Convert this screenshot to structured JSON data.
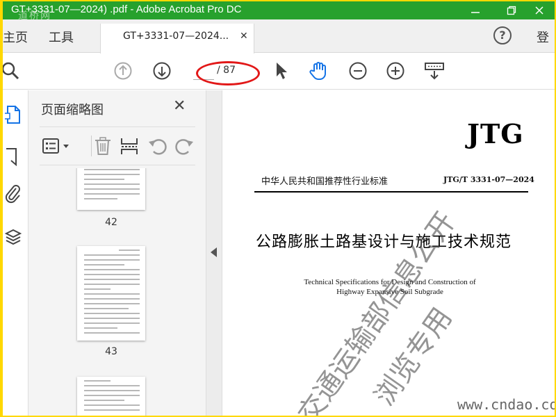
{
  "window": {
    "title": "GT+3331-07—2024)  .pdf - Adobe Acrobat Pro DC",
    "watermark": "道桥网"
  },
  "tabs": {
    "home": "主页",
    "tools": "工具",
    "document": "GT+3331-07—2024...",
    "help": "?",
    "sign_in": "登"
  },
  "toolbar": {
    "page_current": "",
    "page_total": "/ 87"
  },
  "panel": {
    "title": "页面缩略图",
    "thumbnails": [
      {
        "page": "42"
      },
      {
        "page": "43"
      },
      {
        "page": ""
      }
    ]
  },
  "document": {
    "code_mark": "JTG",
    "standard_type": "中华人民共和国推荐性行业标准",
    "standard_code": "JTG/T 3331-07—2024",
    "title_cn": "公路膨胀土路基设计与施工技术规范",
    "title_en_line1": "Technical Specifications for Design and Construction of",
    "title_en_line2": "Highway Expansive Soil Subgrade",
    "watermark_line1": "交通运输部信息公开",
    "watermark_line2": "浏览专用",
    "site_watermark": "www.cndao.com"
  },
  "colors": {
    "titlebar": "#27a12d",
    "border": "#ffd800",
    "annotation_oval": "#e21818",
    "hand_tool": "#1473e6"
  }
}
